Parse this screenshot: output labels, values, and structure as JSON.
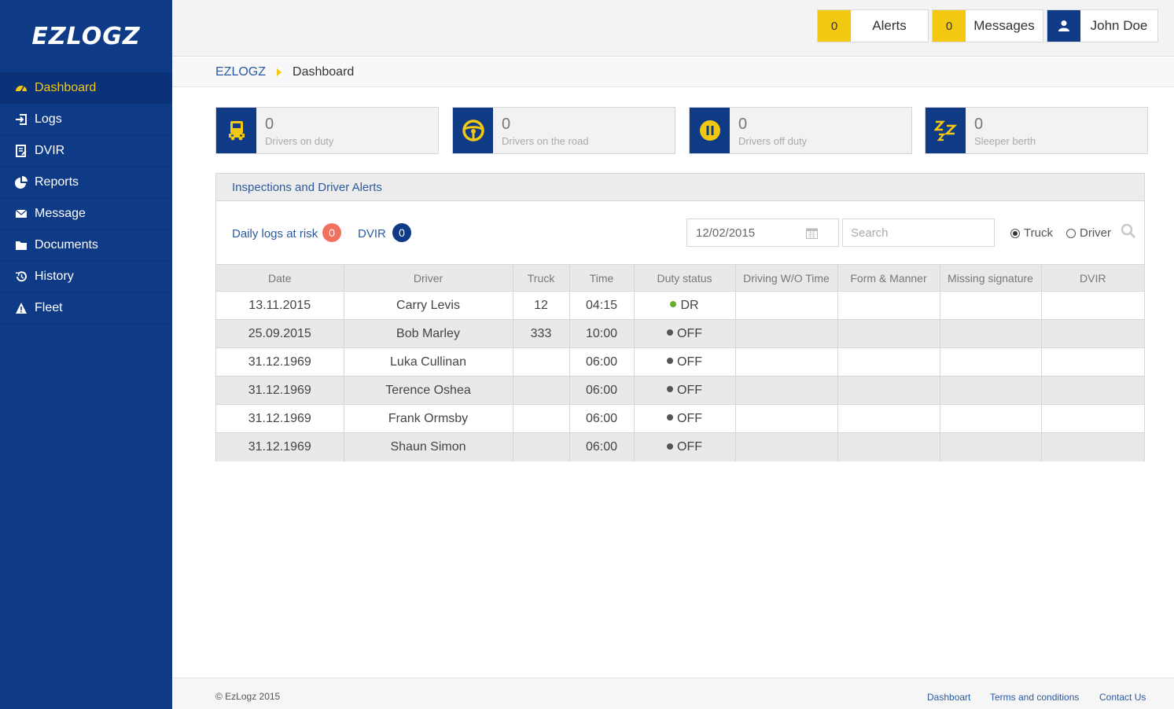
{
  "brand": {
    "logo_text": "EZLOGZ"
  },
  "colors": {
    "sidebar": "#0f3a86",
    "accent": "#f2c811",
    "danger": "#f2705e",
    "dr_status": "#6aab2e",
    "off_status": "#555555"
  },
  "sidebar": {
    "items": [
      {
        "label": "Dashboard",
        "icon": "dashboard-icon",
        "active": true
      },
      {
        "label": "Logs",
        "icon": "logs-icon"
      },
      {
        "label": "DVIR",
        "icon": "dvir-icon"
      },
      {
        "label": "Reports",
        "icon": "reports-icon"
      },
      {
        "label": "Message",
        "icon": "message-icon"
      },
      {
        "label": "Documents",
        "icon": "folder-icon"
      },
      {
        "label": "History",
        "icon": "history-icon"
      },
      {
        "label": "Fleet",
        "icon": "fleet-icon"
      }
    ]
  },
  "topbar": {
    "alerts": {
      "count": "0",
      "label": "Alerts"
    },
    "messages": {
      "count": "0",
      "label": "Messages"
    },
    "user": {
      "name": "John Doe",
      "icon": "user-icon"
    }
  },
  "breadcrumb": {
    "root": "EZLOGZ",
    "current": "Dashboard"
  },
  "stats": [
    {
      "value": "0",
      "label": "Drivers on duty",
      "icon": "truck-icon"
    },
    {
      "value": "0",
      "label": "Drivers on the road",
      "icon": "steering-wheel-icon"
    },
    {
      "value": "0",
      "label": "Drivers off duty",
      "icon": "pause-icon"
    },
    {
      "value": "0",
      "label": "Sleeper berth",
      "icon": "sleep-icon"
    }
  ],
  "panel": {
    "title": "Inspections and Driver Alerts",
    "daily_logs_label": "Daily logs at risk",
    "daily_logs_count": "0",
    "dvir_label": "DVIR",
    "dvir_count": "0",
    "date_value": "12/02/2015",
    "search_placeholder": "Search",
    "radio_truck": "Truck",
    "radio_driver": "Driver",
    "radio_selected": "Truck"
  },
  "table": {
    "headers": [
      "Date",
      "Driver",
      "Truck",
      "Time",
      "Duty status",
      "Driving W/O Time",
      "Form & Manner",
      "Missing signature",
      "DVIR"
    ],
    "rows": [
      {
        "date": "13.11.2015",
        "driver": "Carry Levis",
        "truck": "12",
        "time": "04:15",
        "status": "DR",
        "driving_wo_time": "",
        "form_manner": "",
        "missing_signature": "",
        "dvir": ""
      },
      {
        "date": "25.09.2015",
        "driver": "Bob Marley",
        "truck": "333",
        "time": "10:00",
        "status": "OFF",
        "driving_wo_time": "",
        "form_manner": "",
        "missing_signature": "",
        "dvir": ""
      },
      {
        "date": "31.12.1969",
        "driver": "Luka Cullinan",
        "truck": "",
        "time": "06:00",
        "status": "OFF",
        "driving_wo_time": "",
        "form_manner": "",
        "missing_signature": "",
        "dvir": ""
      },
      {
        "date": "31.12.1969",
        "driver": "Terence Oshea",
        "truck": "",
        "time": "06:00",
        "status": "OFF",
        "driving_wo_time": "",
        "form_manner": "",
        "missing_signature": "",
        "dvir": ""
      },
      {
        "date": "31.12.1969",
        "driver": "Frank Ormsby",
        "truck": "",
        "time": "06:00",
        "status": "OFF",
        "driving_wo_time": "",
        "form_manner": "",
        "missing_signature": "",
        "dvir": ""
      },
      {
        "date": "31.12.1969",
        "driver": "Shaun Simon",
        "truck": "",
        "time": "06:00",
        "status": "OFF",
        "driving_wo_time": "",
        "form_manner": "",
        "missing_signature": "",
        "dvir": ""
      }
    ]
  },
  "footer": {
    "copyright": "© EzLogz 2015",
    "links": [
      "Dashboart",
      "Terms and conditions",
      "Contact Us"
    ]
  }
}
